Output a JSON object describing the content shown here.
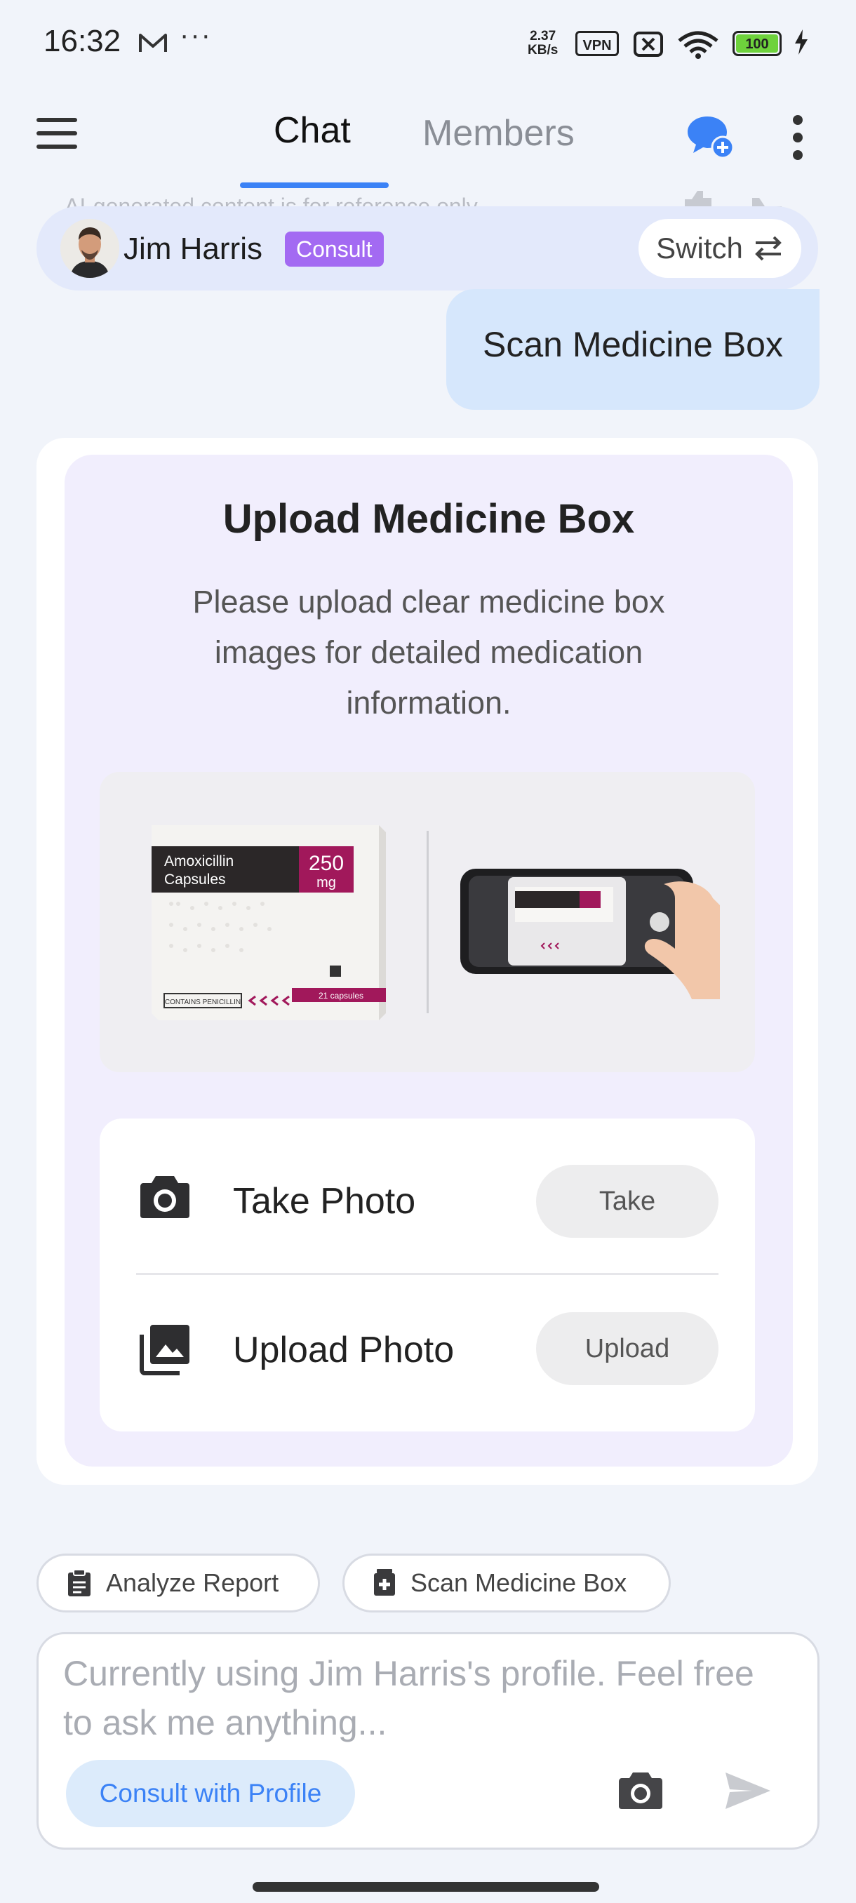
{
  "status_bar": {
    "time": "16:32",
    "dots": "···",
    "speed_value": "2.37",
    "speed_unit": "KB/s",
    "vpn": "VPN",
    "battery": "100"
  },
  "nav": {
    "tab_chat": "Chat",
    "tab_members": "Members"
  },
  "faded_note": "AI-generated content is for reference only",
  "profile": {
    "name": "Jim Harris",
    "badge": "Consult",
    "switch_label": "Switch"
  },
  "user_message": "Scan Medicine Box",
  "upload_card": {
    "title": "Upload Medicine Box",
    "description": "Please upload clear medicine box images for detailed medication information.",
    "box_name_line1": "Amoxicillin",
    "box_name_line2": "Capsules",
    "box_dose": "250",
    "box_unit": "mg",
    "box_footer_left": "CONTAINS PENICILLIN",
    "box_footer_right": "21 capsules",
    "take_label": "Take Photo",
    "take_button": "Take",
    "upload_label": "Upload Photo",
    "upload_button": "Upload"
  },
  "quick_actions": {
    "analyze": "Analyze Report",
    "scan": "Scan Medicine Box"
  },
  "input": {
    "placeholder": "Currently using Jim Harris's profile. Feel free to ask me anything...",
    "consult_button": "Consult with Profile"
  },
  "colors": {
    "accent_blue": "#3b82f6",
    "badge_purple": "#a36af2",
    "card_bg": "#f1eefd",
    "bubble_bg": "#d6e7fc",
    "box_magenta": "#a1185b"
  },
  "icons": [
    "mail-icon",
    "wifi-icon",
    "battery-icon",
    "menu-icon",
    "chat-add-icon",
    "more-vertical-icon",
    "swap-icon",
    "camera-icon",
    "gallery-icon",
    "clipboard-icon",
    "medical-box-icon",
    "send-icon"
  ]
}
